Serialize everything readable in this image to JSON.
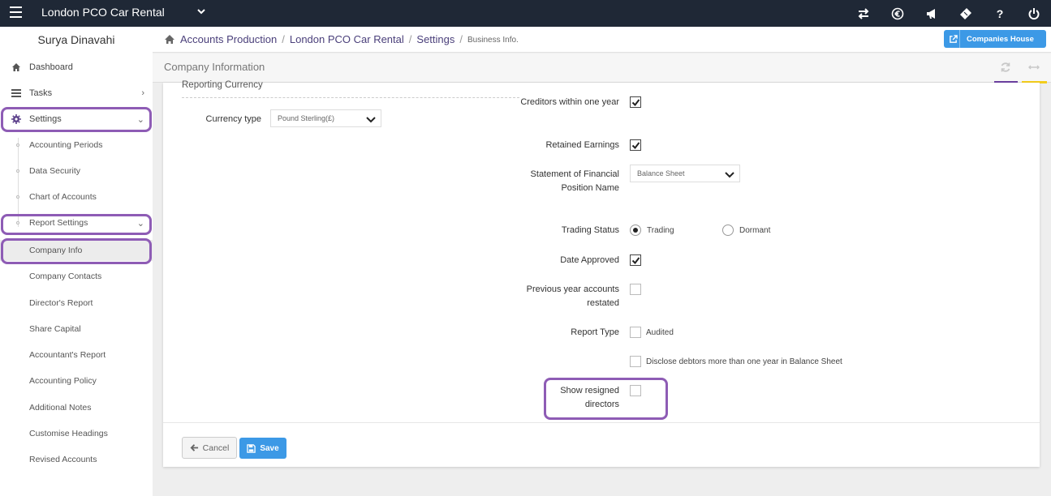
{
  "topbar": {
    "app_title": "London PCO Car Rental",
    "icons": [
      "exchange-icon",
      "euro-icon",
      "megaphone-icon",
      "ticket-icon",
      "help-icon",
      "power-icon"
    ],
    "help_glyph": "?"
  },
  "sidebar": {
    "user_name": "Surya Dinavahi",
    "items": [
      {
        "label": "Dashboard",
        "icon": "home-icon"
      },
      {
        "label": "Tasks",
        "icon": "tasks-icon"
      },
      {
        "label": "Settings",
        "icon": "gear-icon"
      }
    ],
    "sub_items": [
      "Accounting Periods",
      "Data Security",
      "Chart of Accounts",
      "Report Settings",
      "Company Info",
      "Company Contacts",
      "Director's Report",
      "Share Capital",
      "Accountant's Report",
      "Accounting Policy",
      "Additional Notes",
      "Customise Headings",
      "Revised Accounts"
    ]
  },
  "breadcrumb": {
    "items": [
      "Accounts Production",
      "London PCO Car Rental",
      "Settings"
    ],
    "current": "Business Info.",
    "separator": "/"
  },
  "companies_house_button": "Companies House",
  "panel": {
    "title": "Company Information"
  },
  "form": {
    "section_title": "Reporting Currency",
    "currency_type_label": "Currency type",
    "currency_type_value": "Pound Sterling(£)",
    "creditors_label": "Creditors within one year",
    "creditors_checked": true,
    "retained_earnings_label": "Retained Earnings",
    "retained_earnings_checked": true,
    "sofp_label": "Statement of Financial Position Name",
    "sofp_value": "Balance Sheet",
    "trading_status_label": "Trading Status",
    "trading_option": "Trading",
    "dormant_option": "Dormant",
    "trading_status_value": "Trading",
    "date_approved_label": "Date Approved",
    "date_approved_checked": true,
    "prev_year_label": "Previous year accounts restated",
    "prev_year_checked": false,
    "report_type_label": "Report Type",
    "audited_label": "Audited",
    "audited_checked": false,
    "disclose_label": "Disclose debtors more than one year in Balance Sheet",
    "disclose_checked": false,
    "resigned_label": "Show resigned directors",
    "resigned_checked": false
  },
  "buttons": {
    "cancel": "Cancel",
    "save": "Save"
  },
  "colors": {
    "topbar": "#1f2836",
    "accent_blue": "#3c99e6",
    "highlight_purple": "#8e5cb5",
    "link_purple": "#4a3f7a",
    "tab_yellow": "#f3cd1c"
  }
}
